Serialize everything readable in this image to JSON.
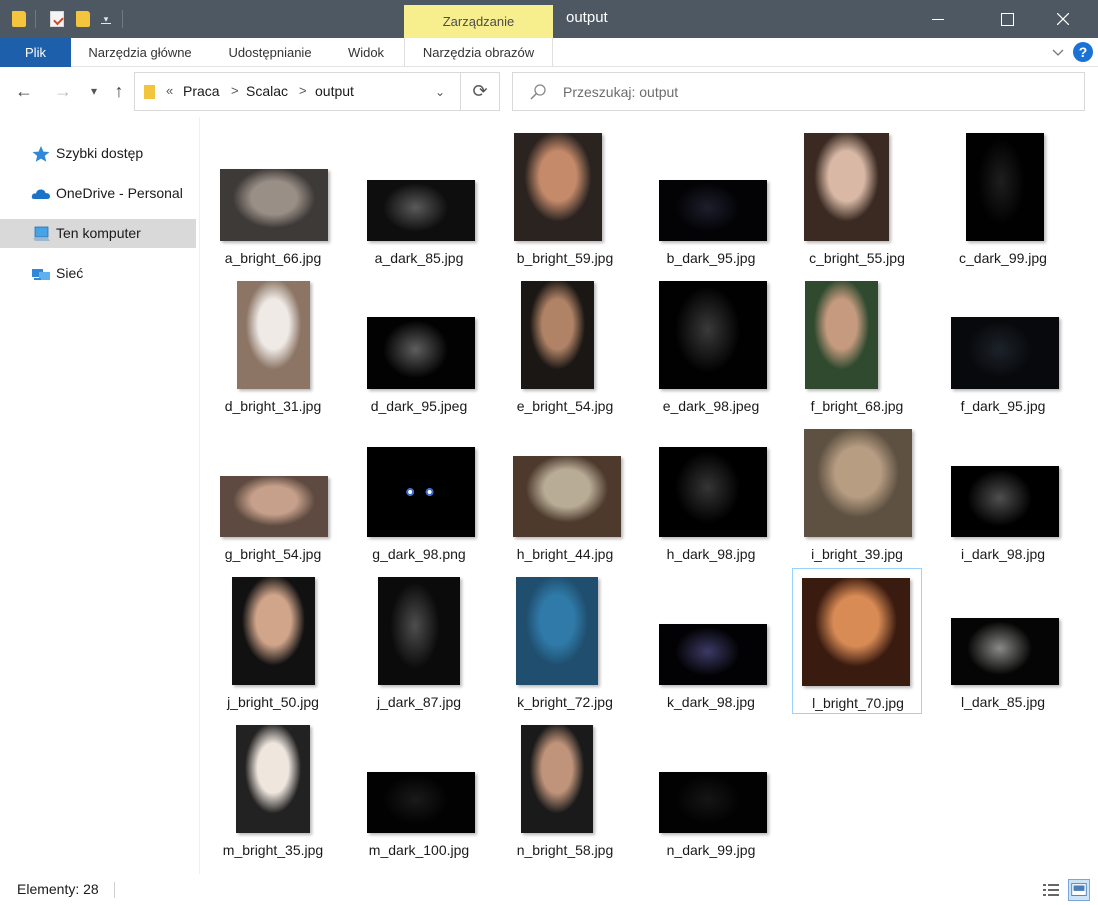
{
  "titlebar": {
    "title": "output",
    "manage_tab": "Zarządzanie"
  },
  "ribbon": {
    "tabs": [
      "Plik",
      "Narzędzia główne",
      "Udostępnianie",
      "Widok",
      "Narzędzia obrazów"
    ],
    "help": "?"
  },
  "addressbar": {
    "overflow": "«",
    "path": [
      "Praca",
      "Scalac",
      "output"
    ],
    "separator": ">"
  },
  "search": {
    "placeholder": "Przeszukaj: output"
  },
  "sidebar": {
    "items": [
      {
        "label": "Szybki dostęp",
        "icon": "star-icon"
      },
      {
        "label": "OneDrive - Personal",
        "icon": "onedrive-cloud-icon"
      },
      {
        "label": "Ten komputer",
        "icon": "computer-icon"
      },
      {
        "label": "Sieć",
        "icon": "network-icon"
      }
    ]
  },
  "files": [
    {
      "name": "a_bright_66.jpg",
      "tone": "bright",
      "colors": [
        "#3e3a38",
        "#9a8f86"
      ]
    },
    {
      "name": "a_dark_85.jpg",
      "tone": "dark",
      "colors": [
        "#0e0e0e",
        "#5a5a5a"
      ]
    },
    {
      "name": "b_bright_59.jpg",
      "tone": "bright",
      "colors": [
        "#2b2320",
        "#c48a6a"
      ]
    },
    {
      "name": "b_dark_95.jpg",
      "tone": "dark",
      "colors": [
        "#030305",
        "#1c1e2c"
      ]
    },
    {
      "name": "c_bright_55.jpg",
      "tone": "bright",
      "colors": [
        "#3a2a22",
        "#d9b9a5"
      ]
    },
    {
      "name": "c_dark_99.jpg",
      "tone": "dark",
      "colors": [
        "#010101",
        "#1e1e1e"
      ]
    },
    {
      "name": "d_bright_31.jpg",
      "tone": "bright",
      "colors": [
        "#8c7565",
        "#efeae6"
      ]
    },
    {
      "name": "d_dark_95.jpeg",
      "tone": "dark",
      "colors": [
        "#020202",
        "#5e5e5e"
      ]
    },
    {
      "name": "e_bright_54.jpg",
      "tone": "bright",
      "colors": [
        "#1b1714",
        "#b08366"
      ]
    },
    {
      "name": "e_dark_98.jpeg",
      "tone": "dark",
      "colors": [
        "#010101",
        "#3a3a3a"
      ]
    },
    {
      "name": "f_bright_68.jpg",
      "tone": "bright",
      "colors": [
        "#2f4a2f",
        "#c59a7e"
      ]
    },
    {
      "name": "f_dark_95.jpg",
      "tone": "dark",
      "colors": [
        "#07090c",
        "#1d222a"
      ]
    },
    {
      "name": "g_bright_54.jpg",
      "tone": "bright",
      "colors": [
        "#5e4a40",
        "#c6a08a"
      ]
    },
    {
      "name": "g_dark_98.png",
      "tone": "dark",
      "colors": [
        "#000000",
        "#ffffff"
      ]
    },
    {
      "name": "h_bright_44.jpg",
      "tone": "bright",
      "colors": [
        "#4d3a2d",
        "#b9ac96"
      ]
    },
    {
      "name": "h_dark_98.jpg",
      "tone": "dark",
      "colors": [
        "#000000",
        "#353535"
      ]
    },
    {
      "name": "i_bright_39.jpg",
      "tone": "bright",
      "colors": [
        "#5e5142",
        "#b79d82"
      ]
    },
    {
      "name": "i_dark_98.jpg",
      "tone": "dark",
      "colors": [
        "#000000",
        "#4f4f4f"
      ]
    },
    {
      "name": "j_bright_50.jpg",
      "tone": "bright",
      "colors": [
        "#111111",
        "#d1a58a"
      ]
    },
    {
      "name": "j_dark_87.jpg",
      "tone": "dark",
      "colors": [
        "#0b0b0b",
        "#4e4e4e"
      ]
    },
    {
      "name": "k_bright_72.jpg",
      "tone": "bright",
      "colors": [
        "#1f4e6e",
        "#2f7aa8"
      ]
    },
    {
      "name": "k_dark_98.jpg",
      "tone": "dark",
      "colors": [
        "#020204",
        "#3c3a66"
      ]
    },
    {
      "name": "l_bright_70.jpg",
      "tone": "bright",
      "colors": [
        "#3a1b10",
        "#d98b55"
      ]
    },
    {
      "name": "l_dark_85.jpg",
      "tone": "dark",
      "colors": [
        "#050505",
        "#8a8a88"
      ]
    },
    {
      "name": "m_bright_35.jpg",
      "tone": "bright",
      "colors": [
        "#222222",
        "#efe6de"
      ]
    },
    {
      "name": "m_dark_100.jpg",
      "tone": "dark",
      "colors": [
        "#020202",
        "#1a1a1a"
      ]
    },
    {
      "name": "n_bright_58.jpg",
      "tone": "bright",
      "colors": [
        "#1a1a1a",
        "#c0947a"
      ]
    },
    {
      "name": "n_dark_99.jpg",
      "tone": "dark",
      "colors": [
        "#020202",
        "#151515"
      ]
    }
  ],
  "selected_file": "l_bright_70.jpg",
  "status": {
    "count": "Elementy: 28"
  },
  "colors": {
    "titlebar": "#4e5863",
    "manage_tab": "#f7ef8e",
    "plik_tab": "#1d5fab",
    "selection_border": "#99d1ff",
    "sidebar_active": "#d9d9d9"
  }
}
